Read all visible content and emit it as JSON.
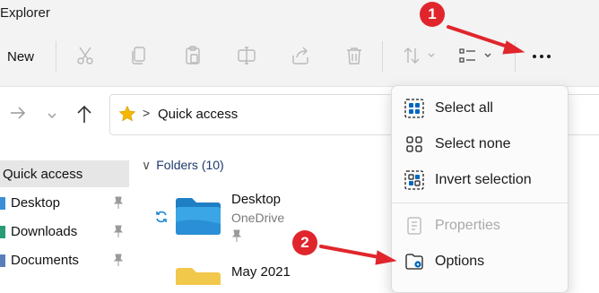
{
  "window": {
    "title": "Explorer"
  },
  "toolbar": {
    "new_label": "New",
    "icons": [
      "cut-icon",
      "copy-icon",
      "paste-icon",
      "rename-icon",
      "share-icon",
      "delete-icon",
      "sort-icon",
      "view-icon",
      "more-icon"
    ]
  },
  "address": {
    "breadcrumb": "Quick access",
    "separator": ">"
  },
  "sidebar": {
    "items": [
      {
        "label": "Quick access",
        "selected": true
      },
      {
        "label": "Desktop",
        "pinned": true
      },
      {
        "label": "Downloads",
        "pinned": true
      },
      {
        "label": "Documents",
        "pinned": true
      }
    ]
  },
  "content": {
    "group_header": "Folders (10)",
    "items": [
      {
        "name": "Desktop",
        "location": "OneDrive",
        "pinned": true
      },
      {
        "name": "May 2021"
      }
    ]
  },
  "menu": {
    "items": [
      {
        "label": "Select all",
        "icon": "select-all-icon",
        "enabled": true
      },
      {
        "label": "Select none",
        "icon": "select-none-icon",
        "enabled": true
      },
      {
        "label": "Invert selection",
        "icon": "invert-selection-icon",
        "enabled": true
      },
      {
        "label": "Properties",
        "icon": "properties-icon",
        "enabled": false
      },
      {
        "label": "Options",
        "icon": "options-icon",
        "enabled": true
      }
    ]
  },
  "annotations": {
    "badge1": "1",
    "badge2": "2"
  },
  "colors": {
    "accent": "#0067c0",
    "annotation_red": "#e0262c",
    "folder_blue": "#2f9ad8"
  }
}
